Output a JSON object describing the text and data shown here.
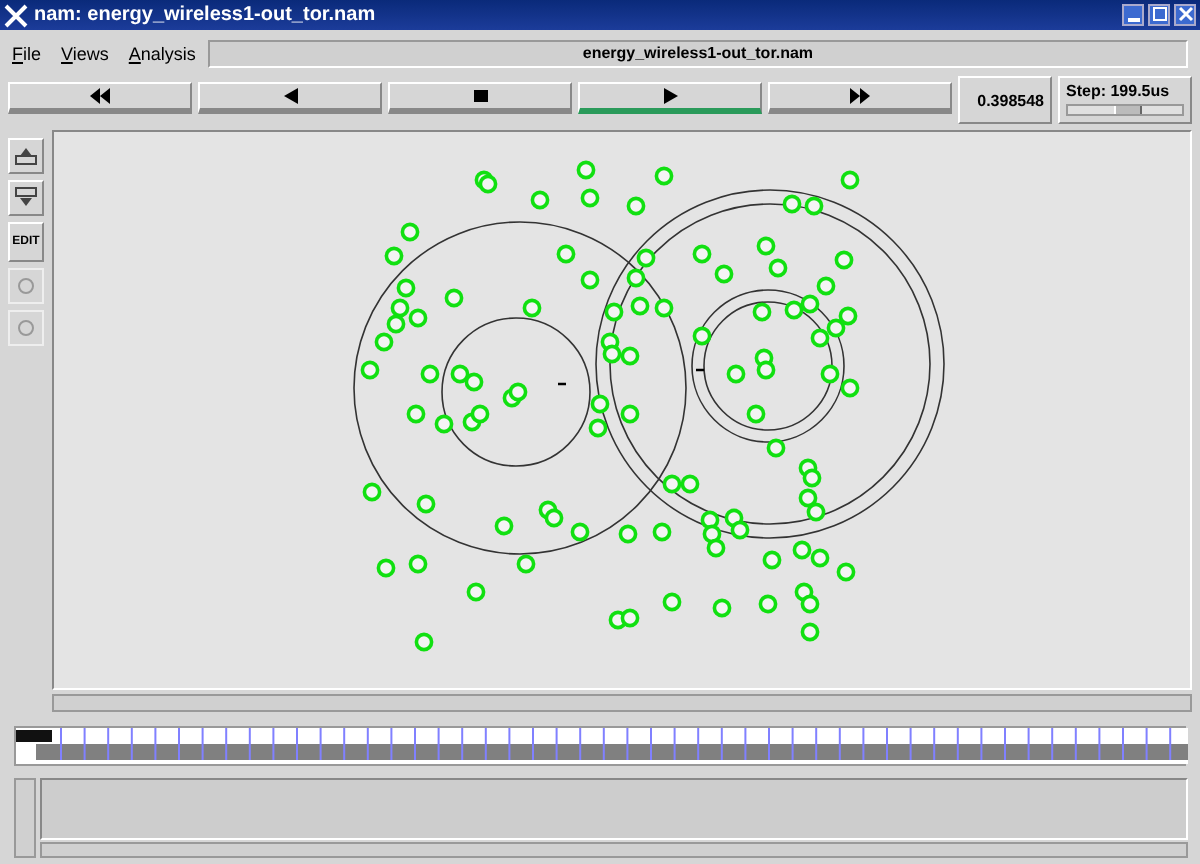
{
  "window": {
    "title": "nam: energy_wireless1-out_tor.nam"
  },
  "menu": [
    {
      "label": "File"
    },
    {
      "label": "Views"
    },
    {
      "label": "Analysis"
    }
  ],
  "file_field": {
    "value": "energy_wireless1-out_tor.nam"
  },
  "playback": [
    {
      "kind": "rewind",
      "selected": false
    },
    {
      "kind": "back",
      "selected": false
    },
    {
      "kind": "stop",
      "selected": false
    },
    {
      "kind": "play",
      "selected": true
    },
    {
      "kind": "forward",
      "selected": false
    }
  ],
  "time": "0.398548",
  "step": {
    "label": "Step: 199.5us",
    "level": 0.5
  },
  "tools": [
    {
      "kind": "zoom-in"
    },
    {
      "kind": "zoom-out"
    },
    {
      "kind": "text",
      "label": "EDIT"
    },
    {
      "kind": "toggle"
    },
    {
      "kind": "toggle"
    }
  ]
}
